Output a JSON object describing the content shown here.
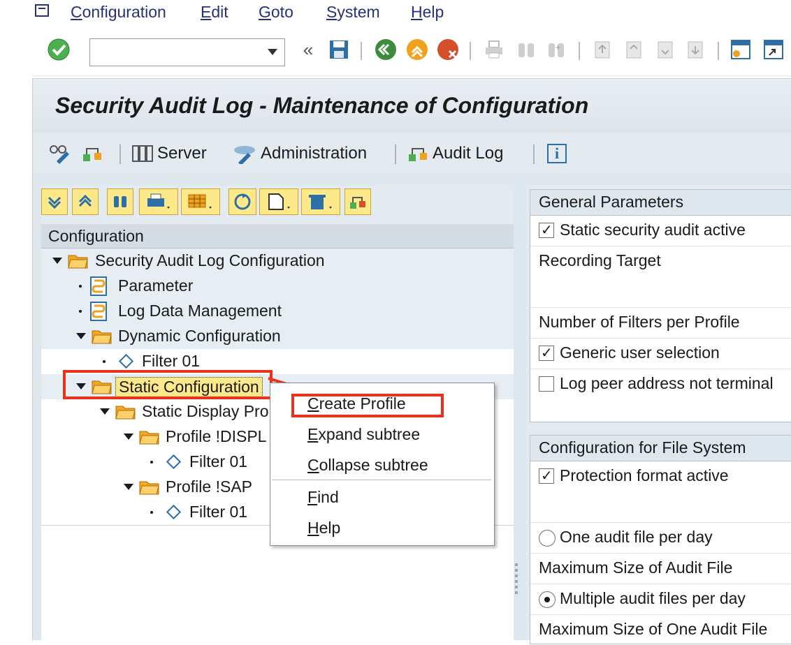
{
  "menu": {
    "items": [
      {
        "label": "Configuration",
        "underline": "C",
        "rest": "onfiguration"
      },
      {
        "label": "Edit",
        "underline": "E",
        "rest": "dit"
      },
      {
        "label": "Goto",
        "underline": "G",
        "rest": "oto"
      },
      {
        "label": "System",
        "underline": "S",
        "rest": "ystem"
      },
      {
        "label": "Help",
        "underline": "H",
        "rest": "elp"
      }
    ]
  },
  "toolbar": {
    "command_value": "",
    "back_glyph": "«"
  },
  "title": "Security Audit Log - Maintenance of Configuration",
  "app_toolbar": {
    "server": "Server",
    "administration": "Administration",
    "audit_log": "Audit Log",
    "info_glyph": "i"
  },
  "tree": {
    "header": "Configuration",
    "rows": [
      {
        "label": "Security Audit Log Configuration"
      },
      {
        "label": "Parameter"
      },
      {
        "label": "Log Data Management"
      },
      {
        "label": "Dynamic Configuration"
      },
      {
        "label": "Filter 01"
      },
      {
        "label": "Static Configuration"
      },
      {
        "label": "Static Display Pro"
      },
      {
        "label": "Profile !DISPL"
      },
      {
        "label": "Filter 01"
      },
      {
        "label": "Profile !SAP"
      },
      {
        "label": "Filter 01"
      }
    ]
  },
  "context_menu": {
    "items": [
      {
        "underline": "C",
        "rest": "reate Profile"
      },
      {
        "underline": "E",
        "rest": "xpand subtree"
      },
      {
        "underline": "C",
        "rest": "ollapse subtree"
      },
      {
        "underline": "F",
        "rest": "ind"
      },
      {
        "underline": "H",
        "rest": "elp"
      }
    ]
  },
  "general_parameters": {
    "header": "General Parameters",
    "static_active": "Static security audit active",
    "recording_target": "Recording Target",
    "filters_per_profile": "Number of Filters per Profile",
    "generic_user": "Generic user selection",
    "log_peer": "Log peer address not terminal"
  },
  "file_system": {
    "header": "Configuration for File System",
    "protection": "Protection format active",
    "one_file": "One audit file per day",
    "max_size": "Maximum Size of Audit File",
    "multiple_files": "Multiple audit files per day",
    "max_one_size": "Maximum Size of One Audit File"
  },
  "colors": {
    "highlight": "#e8321c",
    "menu_text": "#26317a",
    "folder": "#f5a623"
  }
}
